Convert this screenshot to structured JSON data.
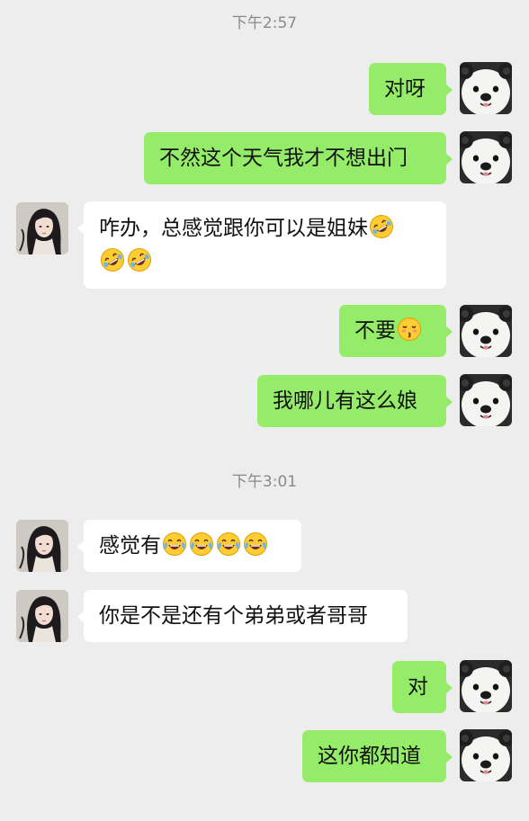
{
  "timestamps": [
    "下午2:57",
    "下午3:01"
  ],
  "messages": [
    {
      "sender": "me",
      "text": "对呀"
    },
    {
      "sender": "me",
      "text": "不然这个天气我才不想出门"
    },
    {
      "sender": "them",
      "text": "咋办，总感觉跟你可以是姐妹",
      "emojis_inline": [
        "rolling-on-floor-laughing"
      ],
      "emojis_line2": [
        "rolling-on-floor-laughing",
        "rolling-on-floor-laughing"
      ]
    },
    {
      "sender": "me",
      "text": "不要",
      "emojis": [
        "kissing-closed-eyes"
      ]
    },
    {
      "sender": "me",
      "text": "我哪儿有这么娘"
    },
    {
      "sender": "them",
      "text": "感觉有",
      "emojis": [
        "tears-of-joy",
        "tears-of-joy",
        "tears-of-joy",
        "tears-of-joy"
      ]
    },
    {
      "sender": "them",
      "text": "你是不是还有个弟弟或者哥哥"
    },
    {
      "sender": "me",
      "text": "对"
    },
    {
      "sender": "me",
      "text": "这你都知道"
    }
  ],
  "avatars": {
    "me": "panda-dog-avatar",
    "them": "girl-portrait-avatar"
  },
  "colors": {
    "background": "#ededed",
    "my_bubble": "#95ec69",
    "their_bubble": "#ffffff",
    "timestamp_text": "#8a8a8a"
  }
}
